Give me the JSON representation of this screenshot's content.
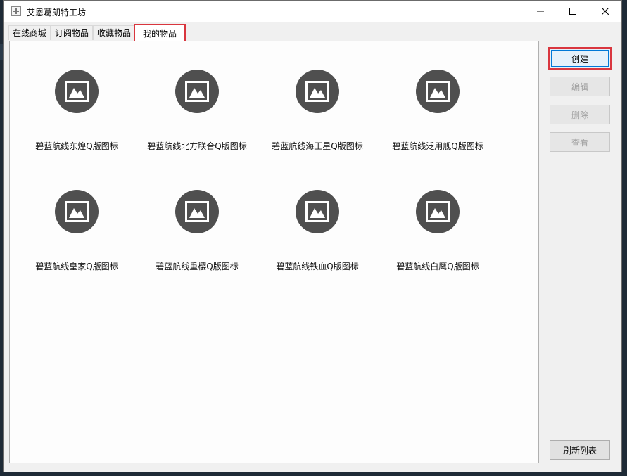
{
  "window": {
    "title": "艾恩葛朗特工坊"
  },
  "tabs": [
    {
      "label": "在线商城"
    },
    {
      "label": "订阅物品"
    },
    {
      "label": "收藏物品"
    },
    {
      "label": "我的物品",
      "active": true
    }
  ],
  "items": [
    {
      "label": "碧蓝航线东煌Q版图标"
    },
    {
      "label": "碧蓝航线北方联合Q版图标"
    },
    {
      "label": "碧蓝航线海王星Q版图标"
    },
    {
      "label": "碧蓝航线泛用舰Q版图标"
    },
    {
      "label": "碧蓝航线皇家Q版图标"
    },
    {
      "label": "碧蓝航线重樱Q版图标"
    },
    {
      "label": "碧蓝航线铁血Q版图标"
    },
    {
      "label": "碧蓝航线白鹰Q版图标"
    }
  ],
  "actions": {
    "create": "创建",
    "edit": "编辑",
    "delete": "删除",
    "view": "查看",
    "refresh": "刷新列表"
  },
  "colors": {
    "highlight": "#d9363e",
    "thumbnail_bg": "#4f4f4f"
  },
  "icons": {
    "item": "image-icon"
  }
}
